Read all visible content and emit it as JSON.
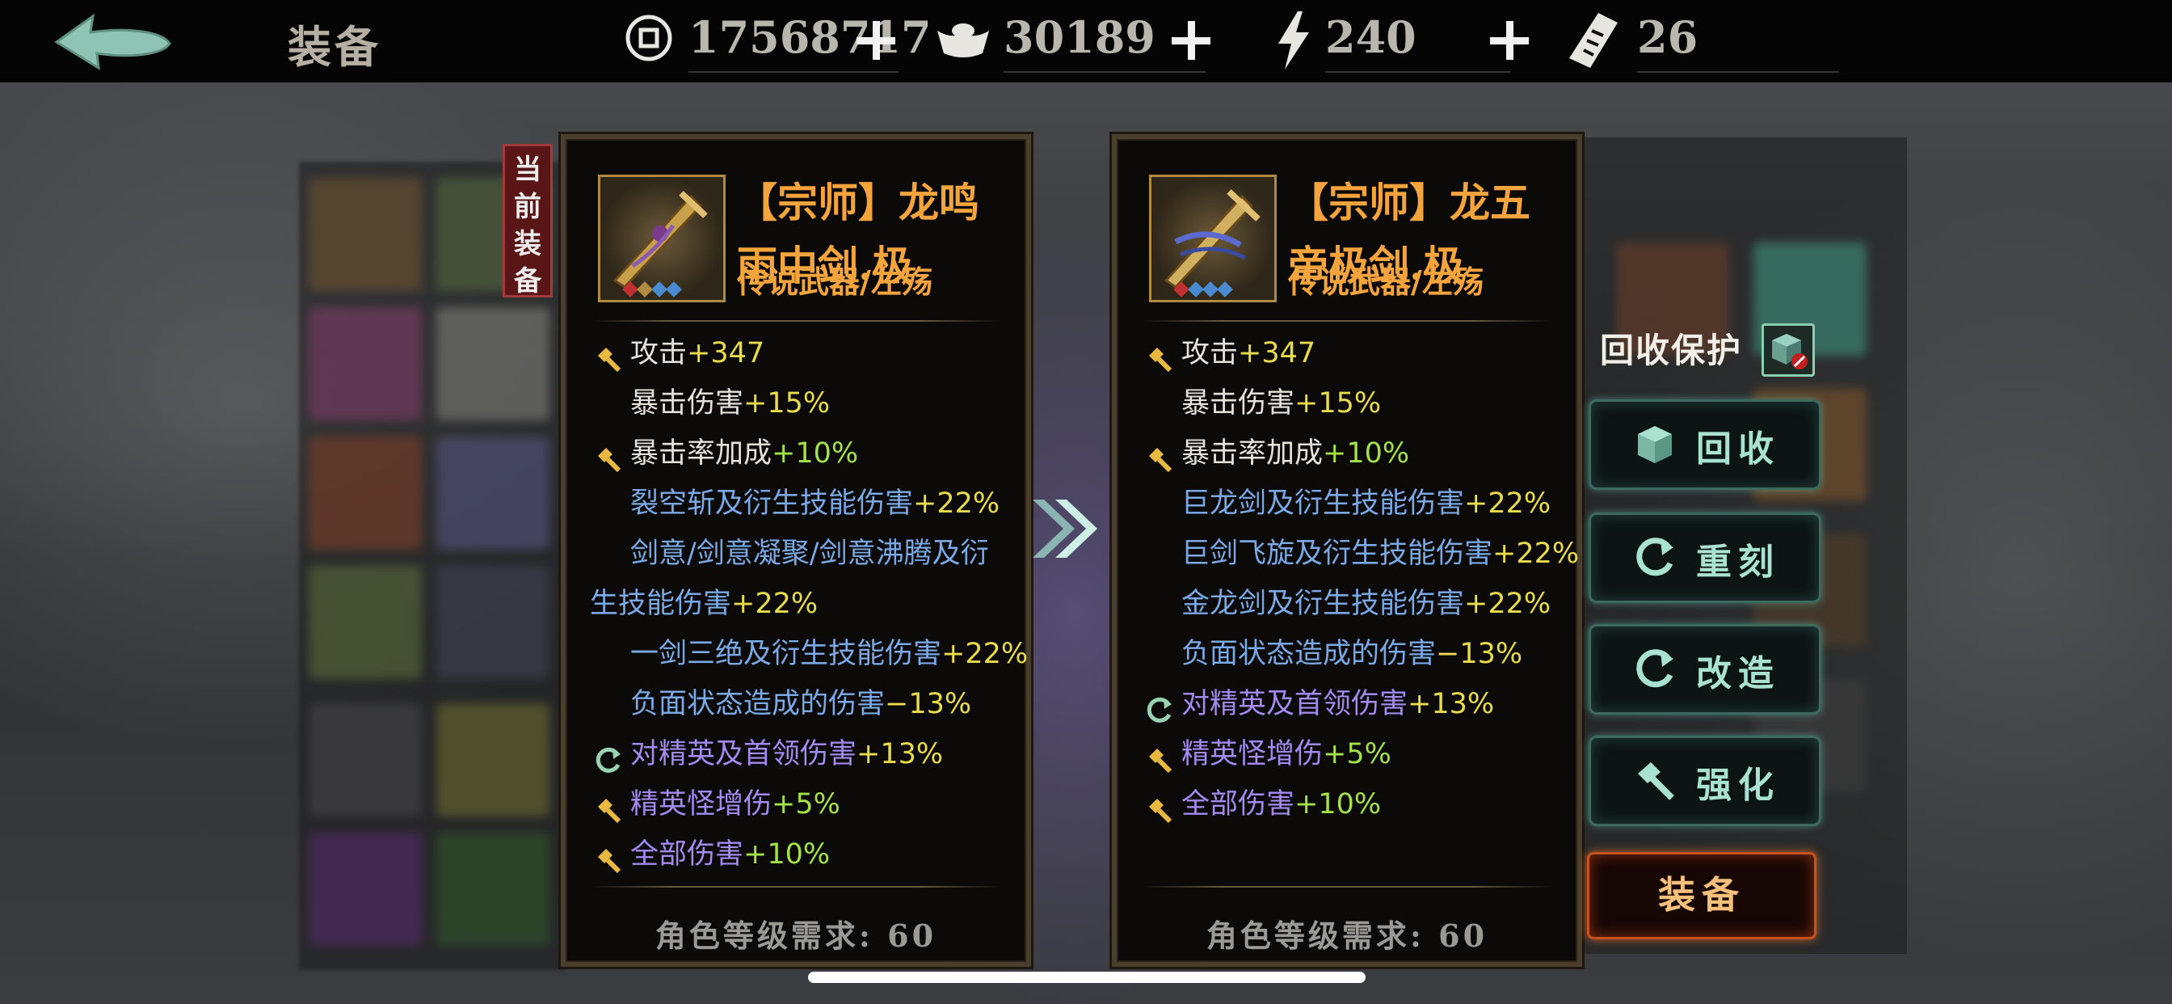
{
  "topbar": {
    "title": "装备",
    "currencies": [
      {
        "icon": "coin-icon",
        "value": "17568717"
      },
      {
        "icon": "silver-ingot-icon",
        "value": "30189"
      },
      {
        "icon": "lightning-icon",
        "value": "240"
      },
      {
        "icon": "talisman-icon",
        "value": "26"
      }
    ]
  },
  "current_badge": "当前装备",
  "current_item": {
    "name": "【宗师】龙鸣雨中剑.极",
    "type": "传说武器/左殇",
    "stats": [
      {
        "marker": "hammer-icon",
        "text": "攻击",
        "bonus": "+347",
        "bonus_color": "yellow",
        "text_color": "white"
      },
      {
        "marker": "",
        "text": "暴击伤害",
        "bonus": "+15%",
        "bonus_color": "yellow",
        "text_color": "white"
      },
      {
        "marker": "hammer-icon",
        "text": "暴击率加成",
        "bonus": "+10%",
        "bonus_color": "green",
        "text_color": "white"
      },
      {
        "marker": "",
        "text": "裂空斩及衍生技能伤害",
        "bonus": "+22%",
        "bonus_color": "yellow",
        "text_color": "blue"
      },
      {
        "marker": "",
        "text": "剑意/剑意凝聚/剑意沸腾及衍",
        "bonus": "",
        "bonus_color": "yellow",
        "text_color": "blue"
      },
      {
        "marker": "",
        "text": "生技能伤害",
        "bonus": "+22%",
        "bonus_color": "yellow",
        "text_color": "blue",
        "indent": "wrap"
      },
      {
        "marker": "",
        "text": "一剑三绝及衍生技能伤害",
        "bonus": "+22%",
        "bonus_color": "yellow",
        "text_color": "blue"
      },
      {
        "marker": "",
        "text": "负面状态造成的伤害",
        "bonus": "−13%",
        "bonus_color": "yellow",
        "text_color": "blue"
      },
      {
        "marker": "refresh-icon",
        "text": "对精英及首领伤害",
        "bonus": "+13%",
        "bonus_color": "yellow",
        "text_color": "purple"
      },
      {
        "marker": "hammer-icon",
        "text": "精英怪增伤",
        "bonus": "+5%",
        "bonus_color": "green",
        "text_color": "purple"
      },
      {
        "marker": "hammer-icon",
        "text": "全部伤害",
        "bonus": "+10%",
        "bonus_color": "green",
        "text_color": "purple"
      }
    ],
    "requirement": "角色等级需求: 60"
  },
  "new_item": {
    "name": "【宗师】龙五帝极剑.极",
    "type": "传说武器/左殇",
    "stats": [
      {
        "marker": "hammer-icon",
        "text": "攻击",
        "bonus": "+347",
        "bonus_color": "yellow",
        "text_color": "white"
      },
      {
        "marker": "",
        "text": "暴击伤害",
        "bonus": "+15%",
        "bonus_color": "yellow",
        "text_color": "white"
      },
      {
        "marker": "hammer-icon",
        "text": "暴击率加成",
        "bonus": "+10%",
        "bonus_color": "green",
        "text_color": "white"
      },
      {
        "marker": "",
        "text": "巨龙剑及衍生技能伤害",
        "bonus": "+22%",
        "bonus_color": "yellow",
        "text_color": "blue"
      },
      {
        "marker": "",
        "text": "巨剑飞旋及衍生技能伤害",
        "bonus": "+22%",
        "bonus_color": "yellow",
        "text_color": "blue"
      },
      {
        "marker": "",
        "text": "金龙剑及衍生技能伤害",
        "bonus": "+22%",
        "bonus_color": "yellow",
        "text_color": "blue"
      },
      {
        "marker": "",
        "text": "负面状态造成的伤害",
        "bonus": "−13%",
        "bonus_color": "yellow",
        "text_color": "blue"
      },
      {
        "marker": "refresh-icon",
        "text": "对精英及首领伤害",
        "bonus": "+13%",
        "bonus_color": "yellow",
        "text_color": "purple"
      },
      {
        "marker": "hammer-icon",
        "text": "精英怪增伤",
        "bonus": "+5%",
        "bonus_color": "green",
        "text_color": "purple"
      },
      {
        "marker": "hammer-icon",
        "text": "全部伤害",
        "bonus": "+10%",
        "bonus_color": "green",
        "text_color": "purple"
      }
    ],
    "requirement": "角色等级需求: 60"
  },
  "actions": {
    "recycle_protect_label": "回收保护",
    "recycle": "回收",
    "reforge": "重刻",
    "modify": "改造",
    "enhance": "强化",
    "equip": "装备"
  },
  "colors": {
    "gold_title": "#f3a43c",
    "stat_white": "#e6e3dc",
    "stat_blue": "#7aa9e6",
    "stat_purple": "#a38af0",
    "bonus_green": "#a4e04a",
    "bonus_yellow": "#e8dc4c",
    "button_teal": "#3e6a5e",
    "equip_orange": "#c8521c"
  }
}
